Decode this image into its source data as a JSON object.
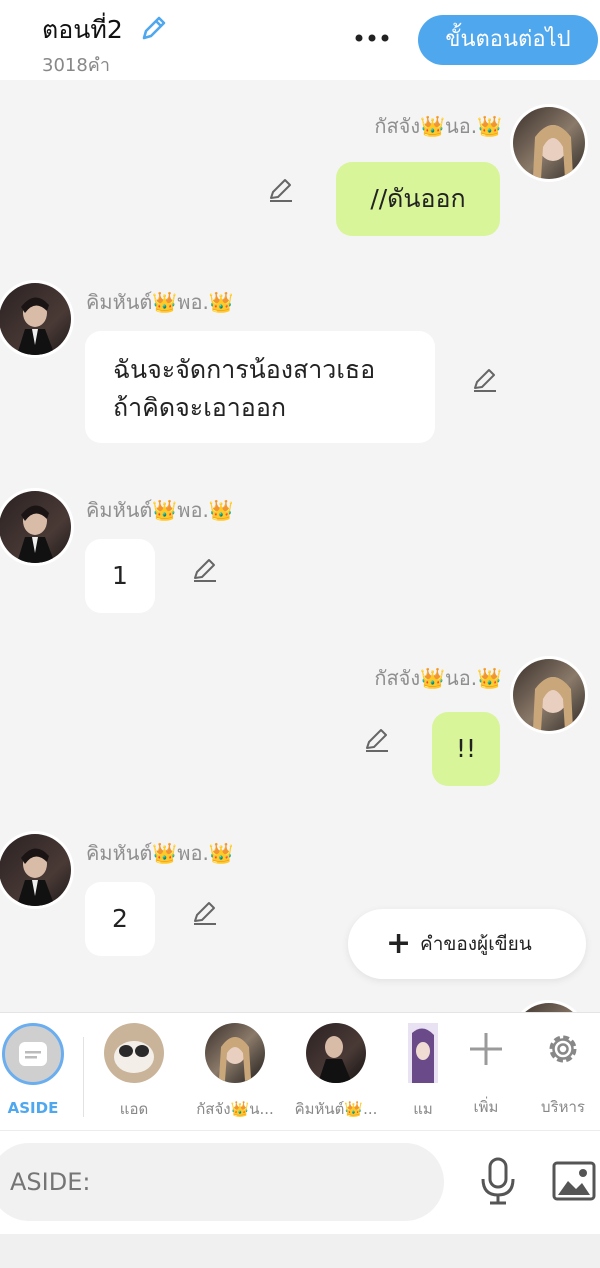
{
  "header": {
    "title": "ตอนที่2",
    "word_count": "3018คำ",
    "next_button": "ขั้นตอนต่อไป"
  },
  "messages": [
    {
      "name": "กัสจัง👑นอ.👑",
      "text": "//ดันออก"
    },
    {
      "name": "คิมหันต์👑พอ.👑",
      "text_line1": "ฉันจะจัดการน้องสาวเธอ",
      "text_line2": "ถ้าคิดจะเอาออก"
    },
    {
      "name": "คิมหันต์👑พอ.👑",
      "text": "1"
    },
    {
      "name": "กัสจัง👑นอ.👑",
      "text": "!!"
    },
    {
      "name": "คิมหันต์👑พอ.👑",
      "text": "2"
    }
  ],
  "writer_note_button": "คำของผู้เขียน",
  "characters": [
    {
      "label": "ASIDE"
    },
    {
      "label": "แอด"
    },
    {
      "label": "กัสจัง👑น..."
    },
    {
      "label": "คิมหันต์👑..."
    },
    {
      "label": "แม"
    },
    {
      "label": "เพิ่ม"
    },
    {
      "label": "บริหาร"
    }
  ],
  "input": {
    "placeholder": "ASIDE:"
  },
  "colors": {
    "accent": "#4fa7ee",
    "green_bubble": "#d8f59a"
  }
}
